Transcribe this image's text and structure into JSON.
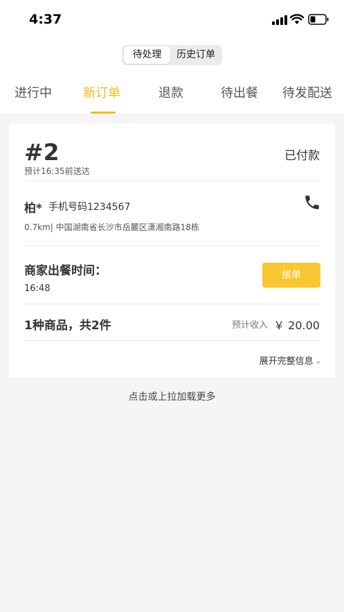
{
  "status_bar": {
    "time": "4:37"
  },
  "segment": {
    "active_label": "待处理",
    "inactive_label": "历史订单"
  },
  "tabs": [
    {
      "label": "进行中"
    },
    {
      "label": "新订单"
    },
    {
      "label": "退款"
    },
    {
      "label": "待出餐"
    },
    {
      "label": "待发配送"
    }
  ],
  "active_tab": "新订单",
  "order": {
    "number": "#2",
    "eta": "预计16:35前送达",
    "status": "已付款",
    "customer_name": "柏*",
    "customer_phone": "手机号码1234567",
    "address": "0.7km| 中国湖南省长沙市岳麓区潇湘南路18栋",
    "prep_label": "商家出餐时间：",
    "prep_time": "16:48",
    "accept_label": "接单",
    "goods_summary": "1种商品，共2件",
    "income_label": "预计收入",
    "income_value": "￥ 20.00",
    "expand_label": "展开完整信息"
  },
  "load_more": "点击或上拉加载更多",
  "colors": {
    "accent": "#f5b91a",
    "button": "#f9c830",
    "background": "#f5f5f5"
  },
  "icons": [
    "signal-icon",
    "wifi-icon",
    "battery-icon",
    "phone-icon",
    "chevron-down-icon"
  ]
}
